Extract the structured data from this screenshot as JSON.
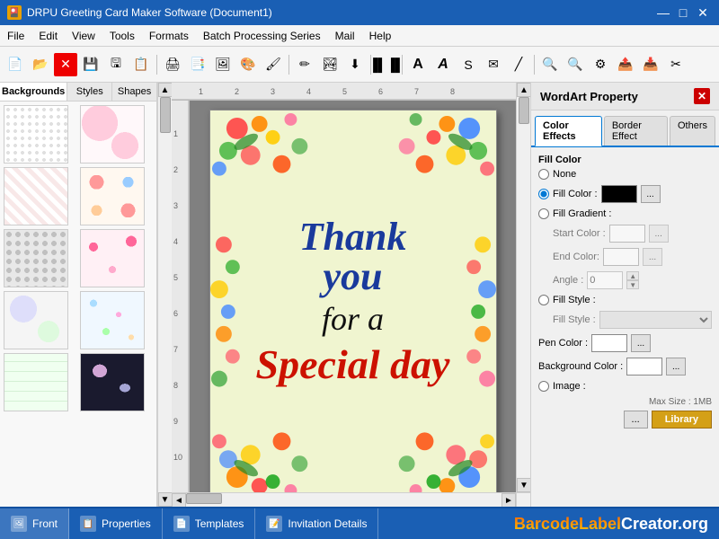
{
  "titleBar": {
    "icon": "🎴",
    "title": "DRPU Greeting Card Maker Software (Document1)",
    "minimize": "—",
    "maximize": "□",
    "close": "✕"
  },
  "menuBar": {
    "items": [
      "File",
      "Edit",
      "View",
      "Tools",
      "Formats",
      "Batch Processing Series",
      "Mail",
      "Help"
    ]
  },
  "leftPanel": {
    "tabs": [
      "Backgrounds",
      "Styles",
      "Shapes"
    ]
  },
  "wordArtPanel": {
    "title": "WordArt Property",
    "close": "✕",
    "tabs": [
      "Color Effects",
      "Border Effect",
      "Others"
    ],
    "fillColor": {
      "label": "Fill Color",
      "noneLabel": "None",
      "fillColorLabel": "Fill Color :",
      "fillGradientLabel": "Fill Gradient :"
    },
    "startColorLabel": "Start Color :",
    "endColorLabel": "End Color:",
    "angleLabel": "Angle :",
    "angleValue": "0",
    "fillStyleLabel": "Fill Style :",
    "fillStyleLabel2": "Fill Style :",
    "penColorLabel": "Pen Color :",
    "bgColorLabel": "Background Color :",
    "imageLabel": "Image :",
    "maxSizeLabel": "Max Size : 1MB",
    "browseBtnLabel": "...",
    "libraryLabel": "Library"
  },
  "canvas": {
    "cardText": {
      "line1": "Thank",
      "line2": "you",
      "line3": "for a",
      "line4": "Special day"
    }
  },
  "bottomBar": {
    "tabs": [
      {
        "label": "Front",
        "icon": "🖼"
      },
      {
        "label": "Properties",
        "icon": "📋"
      },
      {
        "label": "Templates",
        "icon": "📄"
      },
      {
        "label": "Invitation Details",
        "icon": "📝"
      }
    ],
    "brand": "BarcodeLabelCreator.org"
  }
}
